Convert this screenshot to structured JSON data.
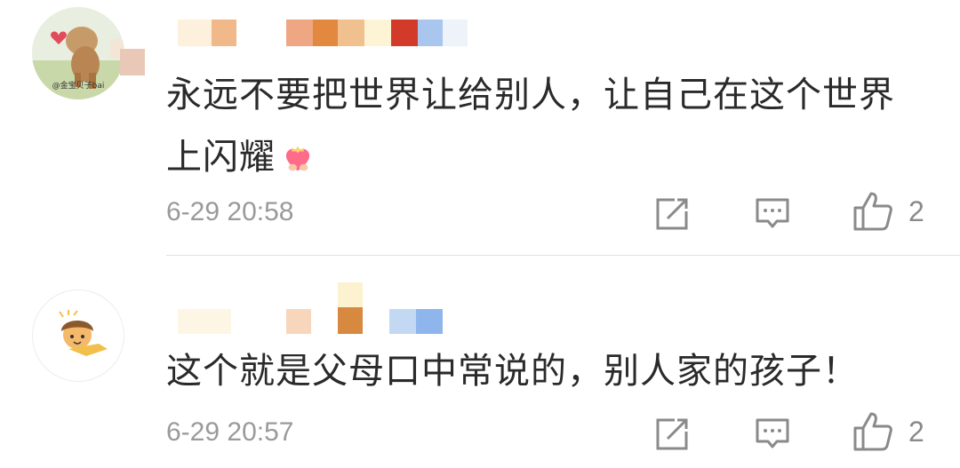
{
  "comments": [
    {
      "avatar_caption": "@金宝贝子bai",
      "text": "永远不要把世界让给别人，让自己在这个世界上闪耀",
      "emoji_icon": "heart-crown-icon",
      "timestamp": "6-29 20:58",
      "like_count": "2"
    },
    {
      "text": "这个就是父母口中常说的，别人家的孩子！",
      "timestamp": "6-29 20:57",
      "like_count": "2"
    }
  ],
  "colors": {
    "text": "#2a2a2a",
    "meta": "#9a9a9a",
    "icon": "#8a8a8a",
    "divider": "#e2e2e2",
    "heart": "#ff6b8a"
  }
}
